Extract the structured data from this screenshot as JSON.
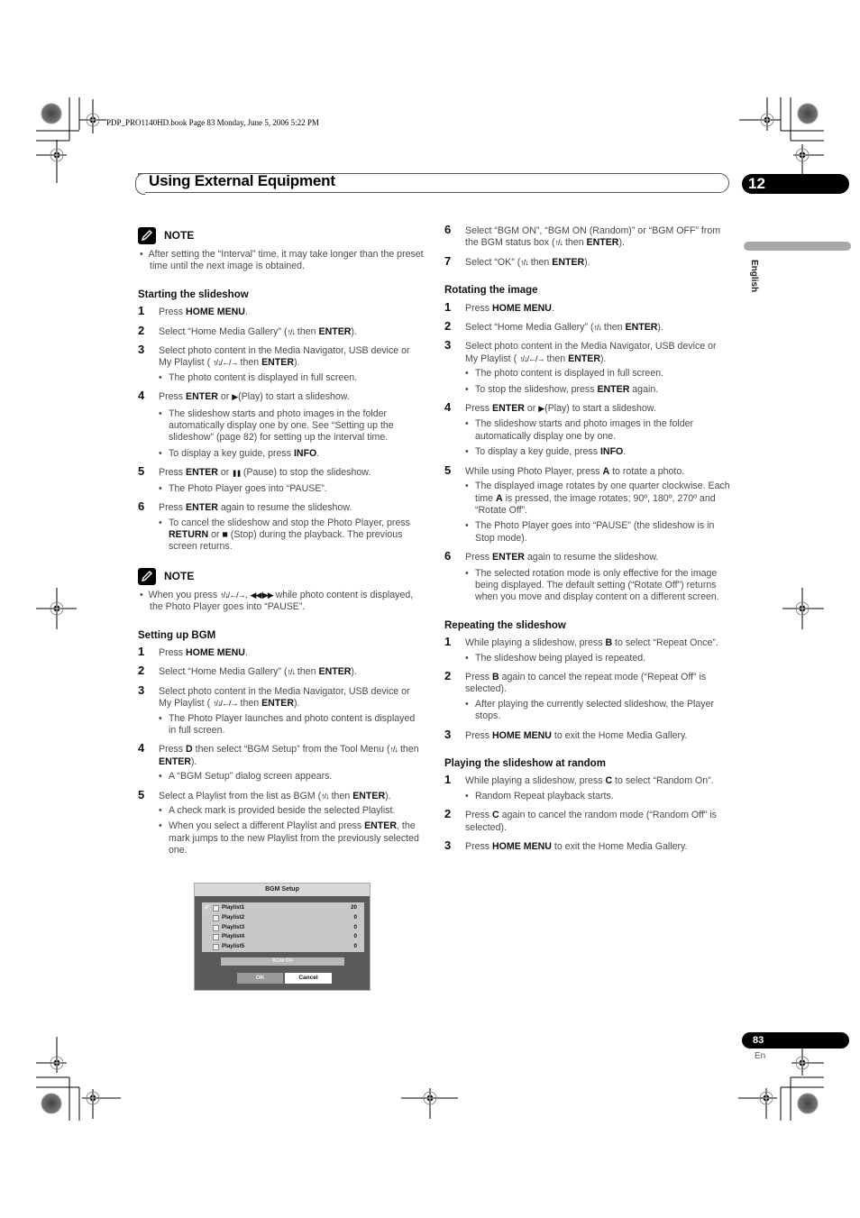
{
  "print_info": "PDP_PRO1140HD.book  Page 83  Monday, June 5, 2006  5:22 PM",
  "header": {
    "title": "Using External Equipment",
    "chapter": "12",
    "language_tab": "English"
  },
  "icons": {
    "up_down": "↑/↓",
    "four_way": "↑/↓/←/→",
    "play": "▶",
    "pause": "❚❚",
    "stop": "■",
    "rew_ff": "◀◀/▶▶"
  },
  "left": {
    "note1": {
      "title": "NOTE",
      "bullet": "After setting the “Interval” time, it may take longer than the preset time until the next image is obtained."
    },
    "starting": {
      "heading": "Starting the slideshow",
      "steps": [
        {
          "num": "1",
          "pre": "Press ",
          "b1": "HOME MENU",
          "post": "."
        },
        {
          "num": "2",
          "pre": "Select “Home Media Gallery” (",
          "mid": " then ",
          "b1": "ENTER",
          "post": ")."
        },
        {
          "num": "3",
          "pre": "Select photo content in the Media Navigator, USB device or My Playlist ( ",
          "mid": " then ",
          "b1": "ENTER",
          "post": ")."
        },
        {
          "num": "4",
          "pre": "Press ",
          "b1": "ENTER",
          "mid": " or ",
          "post": "(Play) to start a slideshow."
        },
        {
          "num": "5",
          "pre": "Press ",
          "b1": "ENTER",
          "mid": " or ",
          "post": " (Pause) to stop the slideshow."
        },
        {
          "num": "6",
          "pre": "Press ",
          "b1": "ENTER",
          "post": " again to resume the slideshow."
        }
      ],
      "step3_bullet": "The photo content is displayed in full screen.",
      "step4_bullet1": "The slideshow starts and photo images in the folder automatically display one by one. See “Setting up the slideshow” (page 82) for setting up the interval time.",
      "step4_bullet2_pre": "To display a key guide, press ",
      "step4_bullet2_b": "INFO",
      "step4_bullet2_post": ".",
      "step5_bullet": "The Photo Player goes into “PAUSE”.",
      "step6_bullet_pre": "To cancel the slideshow and stop the Photo Player, press ",
      "step6_bullet_b": "RETURN",
      "step6_bullet_mid": " or ",
      "step6_bullet_post": " (Stop) during the playback. The previous screen returns."
    },
    "note2": {
      "title": "NOTE",
      "pre": "When you press ",
      "mid": ", ",
      "post": " while photo content is displayed, the Photo Player goes into “PAUSE”."
    },
    "bgm": {
      "heading": "Setting up BGM",
      "s1_pre": "Press ",
      "s1_b": "HOME MENU",
      "s1_post": ".",
      "s2_pre": "Select “Home Media Gallery” (",
      "s2_mid": " then ",
      "s2_b": "ENTER",
      "s2_post": ").",
      "s3_pre": "Select photo content in the Media Navigator, USB device or My Playlist ( ",
      "s3_mid": " then ",
      "s3_b": "ENTER",
      "s3_post": ").",
      "s3_bullet": "The Photo Player launches and photo content is displayed in full screen.",
      "s4_pre": "Press ",
      "s4_b1": "D",
      "s4_mid": " then select “BGM Setup” from the Tool Menu (",
      "s4_mid2": " then ",
      "s4_b2": "ENTER",
      "s4_post": ").",
      "s4_bullet": "A “BGM Setup” dialog screen appears.",
      "s5_pre": "Select a Playlist from the list as BGM (",
      "s5_mid": " then ",
      "s5_b": "ENTER",
      "s5_post": ").",
      "s5_bullet1": "A check mark is provided beside the selected Playlist.",
      "s5_bullet2_pre": "When you select a different Playlist and press ",
      "s5_bullet2_b": "ENTER",
      "s5_bullet2_post": ", the mark jumps to the new Playlist from the previously selected one."
    }
  },
  "dialog": {
    "title": "BGM Setup",
    "playlists": [
      {
        "name": "Playlist1",
        "count": "20",
        "checked": true
      },
      {
        "name": "Playlist2",
        "count": "0",
        "checked": false
      },
      {
        "name": "Playlist3",
        "count": "0",
        "checked": false
      },
      {
        "name": "Playlist4",
        "count": "0",
        "checked": false
      },
      {
        "name": "Playlist5",
        "count": "0",
        "checked": false
      }
    ],
    "check": "✔",
    "status": "BGM ON",
    "ok": "OK",
    "cancel": "Cancel"
  },
  "right": {
    "bgm_cont": {
      "s6_pre": "Select “BGM ON”, “BGM ON (Random)” or “BGM OFF” from the BGM status box (",
      "s6_mid": " then ",
      "s6_b": "ENTER",
      "s6_post": ").",
      "s7_pre": "Select “OK” (",
      "s7_mid": " then ",
      "s7_b": "ENTER",
      "s7_post": ")."
    },
    "rotate": {
      "heading": "Rotating the image",
      "s1_pre": "Press ",
      "s1_b": "HOME MENU",
      "s1_post": ".",
      "s2_pre": "Select “Home Media Gallery” (",
      "s2_mid": " then ",
      "s2_b": "ENTER",
      "s2_post": ").",
      "s3_pre": "Select photo content in the Media Navigator, USB device or My Playlist ( ",
      "s3_mid": " then ",
      "s3_b": "ENTER",
      "s3_post": ").",
      "s3_bullet1": "The photo content is displayed in full screen.",
      "s3_bullet2_pre": "To stop the slideshow, press ",
      "s3_bullet2_b": "ENTER",
      "s3_bullet2_post": " again.",
      "s4_pre": "Press ",
      "s4_b": "ENTER",
      "s4_mid": " or ",
      "s4_post": "(Play) to start a slideshow.",
      "s4_bullet1": "The slideshow starts and photo images in the folder automatically display one by one.",
      "s4_bullet2_pre": "To display a key guide, press ",
      "s4_bullet2_b": "INFO",
      "s4_bullet2_post": ".",
      "s5_pre": "While using Photo Player, press ",
      "s5_b": "A",
      "s5_post": " to rotate a photo.",
      "s5_bullet1_pre": "The displayed image rotates by one quarter clockwise. Each time ",
      "s5_bullet1_b": "A",
      "s5_bullet1_post": " is pressed, the image rotates; 90º, 180º, 270º and “Rotate Off”.",
      "s5_bullet2": "The Photo Player goes into “PAUSE” (the slideshow is in Stop mode).",
      "s6_pre": "Press ",
      "s6_b": "ENTER",
      "s6_post": " again to resume the slideshow.",
      "s6_bullet": "The selected rotation mode is only effective for the image being displayed. The default setting (“Rotate Off”) returns when you move and display content on a different screen."
    },
    "repeat": {
      "heading": "Repeating the slideshow",
      "s1_pre": "While playing a slideshow, press ",
      "s1_b": "B",
      "s1_post": " to select “Repeat Once”.",
      "s1_bullet": "The slideshow being played is repeated.",
      "s2_pre": "Press ",
      "s2_b": "B",
      "s2_post": " again to cancel the repeat mode (“Repeat Off” is selected).",
      "s2_bullet": "After playing the currently selected slideshow, the Player stops.",
      "s3_pre": "Press ",
      "s3_b": "HOME MENU",
      "s3_post": " to exit the Home Media Gallery."
    },
    "random": {
      "heading": "Playing the slideshow at random",
      "s1_pre": "While playing a slideshow, press ",
      "s1_b": "C",
      "s1_post": " to select “Random On”.",
      "s1_bullet": "Random Repeat playback starts.",
      "s2_pre": "Press ",
      "s2_b": "C",
      "s2_post": " again to cancel the random mode (“Random Off” is selected).",
      "s3_pre": "Press ",
      "s3_b": "HOME MENU",
      "s3_post": " to exit the Home Media Gallery."
    }
  },
  "footer": {
    "page_number": "83",
    "language": "En"
  }
}
